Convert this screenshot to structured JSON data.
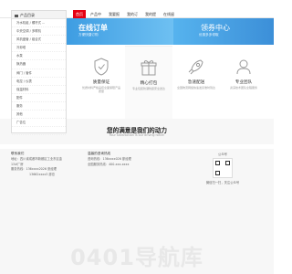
{
  "nav": {
    "categories_label": "产品目录",
    "items": [
      "首页",
      "产品中心",
      "我要报价",
      "我的订单",
      "我的提醒",
      "在线留言"
    ]
  },
  "sidebar": {
    "items": [
      {
        "label": "冷水机组 / 螺杆式 ..."
      },
      {
        "label": "中央空调 / 多联机"
      },
      {
        "label": "风机盘管 / 组合式"
      },
      {
        "label": "冷却塔"
      },
      {
        "label": "水泵"
      },
      {
        "label": "换热器"
      },
      {
        "label": "阀门 / 管件"
      },
      {
        "label": "电控 / 仪表"
      },
      {
        "label": "保温材料"
      },
      {
        "label": "配件"
      },
      {
        "label": "服务"
      },
      {
        "label": "其他"
      },
      {
        "label": "广告位"
      },
      {
        "label": ""
      }
    ]
  },
  "banners": [
    {
      "title": "在线订单",
      "subtitle": "方便快捷订购"
    },
    {
      "title": "领券中心",
      "subtitle": "优惠多多领取"
    }
  ],
  "features": [
    {
      "title": "质量保证",
      "desc": "优质材料严格品控全面保障产品质量",
      "icon": "shield-icon"
    },
    {
      "title": "精心打包",
      "desc": "专业包装防潮防震安全送达",
      "icon": "gift-icon"
    },
    {
      "title": "急速配送",
      "desc": "全国物流网络快速发货准时到达",
      "icon": "rocket-icon"
    },
    {
      "title": "专业团队",
      "desc": "资深技术团队全程服务",
      "icon": "user-icon"
    }
  ],
  "slogan": {
    "title": "您的满意是我们的动力",
    "subtitle": "Your satisfaction is our driving force!"
  },
  "footer": {
    "contact": {
      "title": "联系我们",
      "lines": [
        "地址：四川省成都市新都区工业东区金",
        "13#厂房",
        "服务热线：136xxxx2026 张经理",
        "13662xxxx3 廖总"
      ]
    },
    "hotline": {
      "title": "温馨的咨询热线",
      "lines": [
        "咨询热线：136xxxx026 廖经理",
        "全国服务热线：400-xxx-xxxx"
      ]
    },
    "qr": {
      "title": "公众号",
      "caption": "微信扫一扫，关注公众号"
    }
  },
  "watermark": "0401导航库"
}
